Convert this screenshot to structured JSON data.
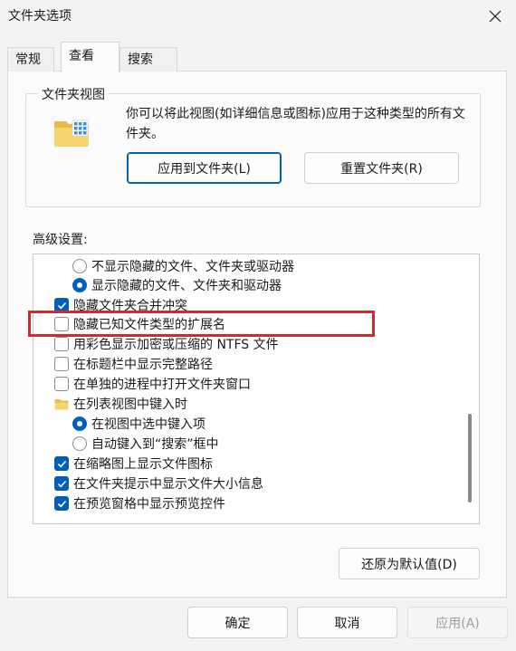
{
  "window": {
    "title": "文件夹选项"
  },
  "tabs": [
    {
      "label": "常规"
    },
    {
      "label": "查看"
    },
    {
      "label": "搜索"
    }
  ],
  "folder_views": {
    "legend": "文件夹视图",
    "description": "你可以将此视图(如详细信息或图标)应用于这种类型的所有文件夹。",
    "apply_button": "应用到文件夹(L)",
    "reset_button": "重置文件夹(R)"
  },
  "advanced": {
    "label": "高级设置:",
    "items": [
      {
        "type": "radio",
        "label": "不显示隐藏的文件、文件夹或驱动器",
        "selected": false
      },
      {
        "type": "radio",
        "label": "显示隐藏的文件、文件夹和驱动器",
        "selected": true
      },
      {
        "type": "checkbox",
        "label": "隐藏文件夹合并冲突",
        "checked": true
      },
      {
        "type": "checkbox",
        "label": "隐藏已知文件类型的扩展名",
        "checked": false
      },
      {
        "type": "checkbox",
        "label": "用彩色显示加密或压缩的 NTFS 文件",
        "checked": false
      },
      {
        "type": "checkbox",
        "label": "在标题栏中显示完整路径",
        "checked": false
      },
      {
        "type": "checkbox",
        "label": "在单独的进程中打开文件夹窗口",
        "checked": false
      },
      {
        "type": "folder",
        "label": "在列表视图中键入时"
      },
      {
        "type": "radio",
        "label": "在视图中选中键入项",
        "selected": true
      },
      {
        "type": "radio",
        "label": "自动键入到“搜索”框中",
        "selected": false
      },
      {
        "type": "checkbox",
        "label": "在缩略图上显示文件图标",
        "checked": true
      },
      {
        "type": "checkbox",
        "label": "在文件夹提示中显示文件大小信息",
        "checked": true
      },
      {
        "type": "checkbox",
        "label": "在预览窗格中显示预览控件",
        "checked": true
      }
    ]
  },
  "restore_button": "还原为默认值(D)",
  "footer": {
    "ok": "确定",
    "cancel": "取消",
    "apply": "应用(A)"
  },
  "colors": {
    "accent": "#005fb8",
    "highlight": "#d9262c"
  }
}
